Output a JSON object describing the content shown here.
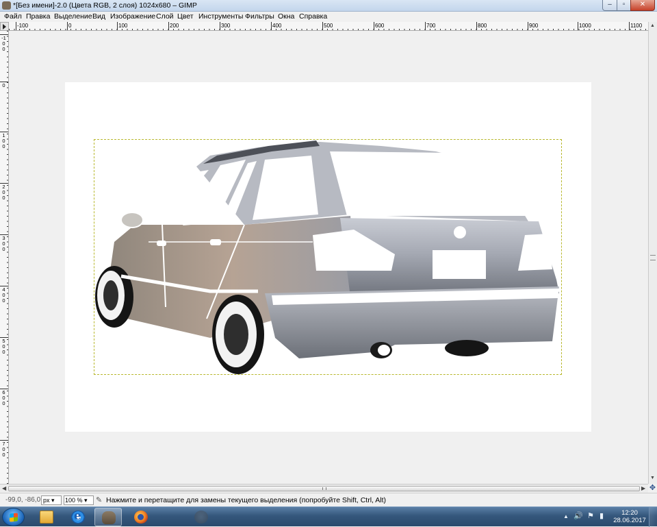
{
  "window": {
    "title": "*[Без имени]-2.0 (Цвета RGB, 2 слоя) 1024x680 – GIMP",
    "minimize": "–",
    "maximize": "▫",
    "close": "✕"
  },
  "menu": [
    "Файл",
    "Правка",
    "Выделение",
    "Вид",
    "Изображение",
    "Слой",
    "Цвет",
    "Инструменты",
    "Фильтры",
    "Окна",
    "Справка"
  ],
  "hruler": [
    "-100",
    "0",
    "100",
    "200",
    "300",
    "400",
    "500",
    "600",
    "700",
    "800",
    "900",
    "1000",
    "1100"
  ],
  "vruler": [
    "-1\n0\n0",
    "0",
    "1\n0\n0",
    "2\n0\n0",
    "3\n0\n0",
    "4\n0\n0",
    "5\n0\n0",
    "6\n0\n0",
    "7\n0\n0"
  ],
  "status": {
    "coords": "-99,0, -86,0",
    "unit": "px ▾",
    "zoom": "100 % ▾",
    "hint": "Нажмите и перетащите для замены текущего выделения (попробуйте Shift, Ctrl, Alt)"
  },
  "taskbar": {
    "apps": [
      "Проводник",
      "Internet Explorer",
      "GIMP",
      "Firefox",
      "Приложение"
    ],
    "tray": [
      "▲",
      "🔊",
      "⚑",
      "▮"
    ],
    "time": "12:20",
    "date": "28.06.2017"
  },
  "icons": {
    "ruler_corner": "triangle-right-icon",
    "navigate": "navigate-icon",
    "hint": "pen-tool-icon"
  }
}
